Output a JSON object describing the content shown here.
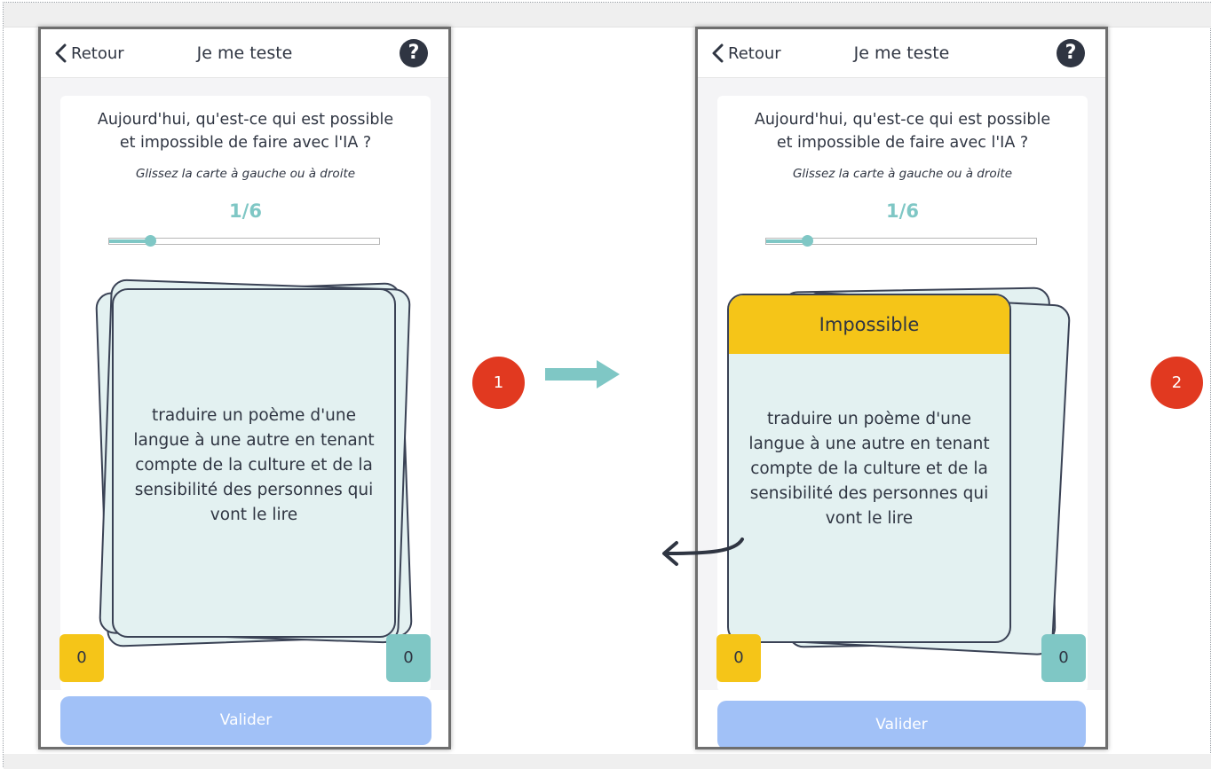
{
  "left_screen": {
    "header": {
      "back_label": "Retour",
      "title": "Je me teste",
      "help_symbol": "?"
    },
    "question": "Aujourd'hui, qu'est-ce qui est possible et impossible de faire avec l'IA ?",
    "hint": "Glissez la carte à gauche ou à droite",
    "counter": "1/6",
    "progress": 0.15,
    "card_text": "traduire un poème d'une langue à une autre en tenant compte de la culture et de la sensibilité des personnes qui vont le lire",
    "score_left": "0",
    "score_right": "0",
    "validate_label": "Valider"
  },
  "right_screen": {
    "header": {
      "back_label": "Retour",
      "title": "Je me teste",
      "help_symbol": "?"
    },
    "question": "Aujourd'hui, qu'est-ce qui est possible et impossible de faire avec l'IA ?",
    "hint": "Glissez la carte à gauche ou à droite",
    "counter": "1/6",
    "progress": 0.15,
    "card_banner": "Impossible",
    "card_text": "traduire un poème d'une langue à une autre en tenant compte de la culture et de la sensibilité des personnes qui vont le lire",
    "score_left": "0",
    "score_right": "0",
    "validate_label": "Valider"
  },
  "step_badges": [
    "1",
    "2"
  ],
  "colors": {
    "accent_teal": "#7fc7c5",
    "impossible_yellow": "#f5c518",
    "card_bg": "#e3f1f1",
    "step_red": "#e13920",
    "validate_blue": "#a1c1f7",
    "text_dark": "#2f3542"
  },
  "icons": [
    "back-chevron-icon",
    "help-icon",
    "right-arrow-icon",
    "swipe-left-arrow-icon"
  ]
}
